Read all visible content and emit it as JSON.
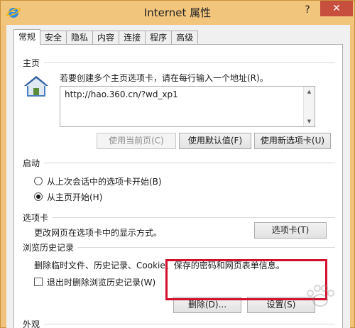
{
  "window": {
    "title": "Internet 属性",
    "help": "?",
    "close": "✕"
  },
  "tabs": [
    {
      "label": "常规",
      "active": true
    },
    {
      "label": "安全"
    },
    {
      "label": "隐私"
    },
    {
      "label": "内容"
    },
    {
      "label": "连接"
    },
    {
      "label": "程序"
    },
    {
      "label": "高级"
    }
  ],
  "home": {
    "title": "主页",
    "instruction": "若要创建多个主页选项卡，请在每行输入一个地址(R)。",
    "url": "http://hao.360.cn/?wd_xp1",
    "buttons": {
      "use_current": "使用当前页(C)",
      "use_default": "使用默认值(F)",
      "use_new_tab": "使用新选项卡(U)"
    }
  },
  "startup": {
    "title": "启动",
    "option_last_session": "从上次会话中的选项卡开始(B)",
    "option_home": "从主页开始(H)",
    "selected": "option_home"
  },
  "tabs_section": {
    "title": "选项卡",
    "description": "更改网页在选项卡中的显示方式。",
    "button": "选项卡(T)"
  },
  "history": {
    "title": "浏览历史记录",
    "description": "删除临时文件、历史记录、Cookie、保存的密码和网页表单信息。",
    "delete_on_exit": "退出时删除浏览历史记录(W)",
    "delete_on_exit_checked": false,
    "delete_button": "删除(D)...",
    "settings_button": "设置(S)"
  },
  "appearance": {
    "title": "外观"
  },
  "colors": {
    "titlebar": "#f2c57d",
    "close": "#c74f3d",
    "highlight": "#d2102b"
  }
}
